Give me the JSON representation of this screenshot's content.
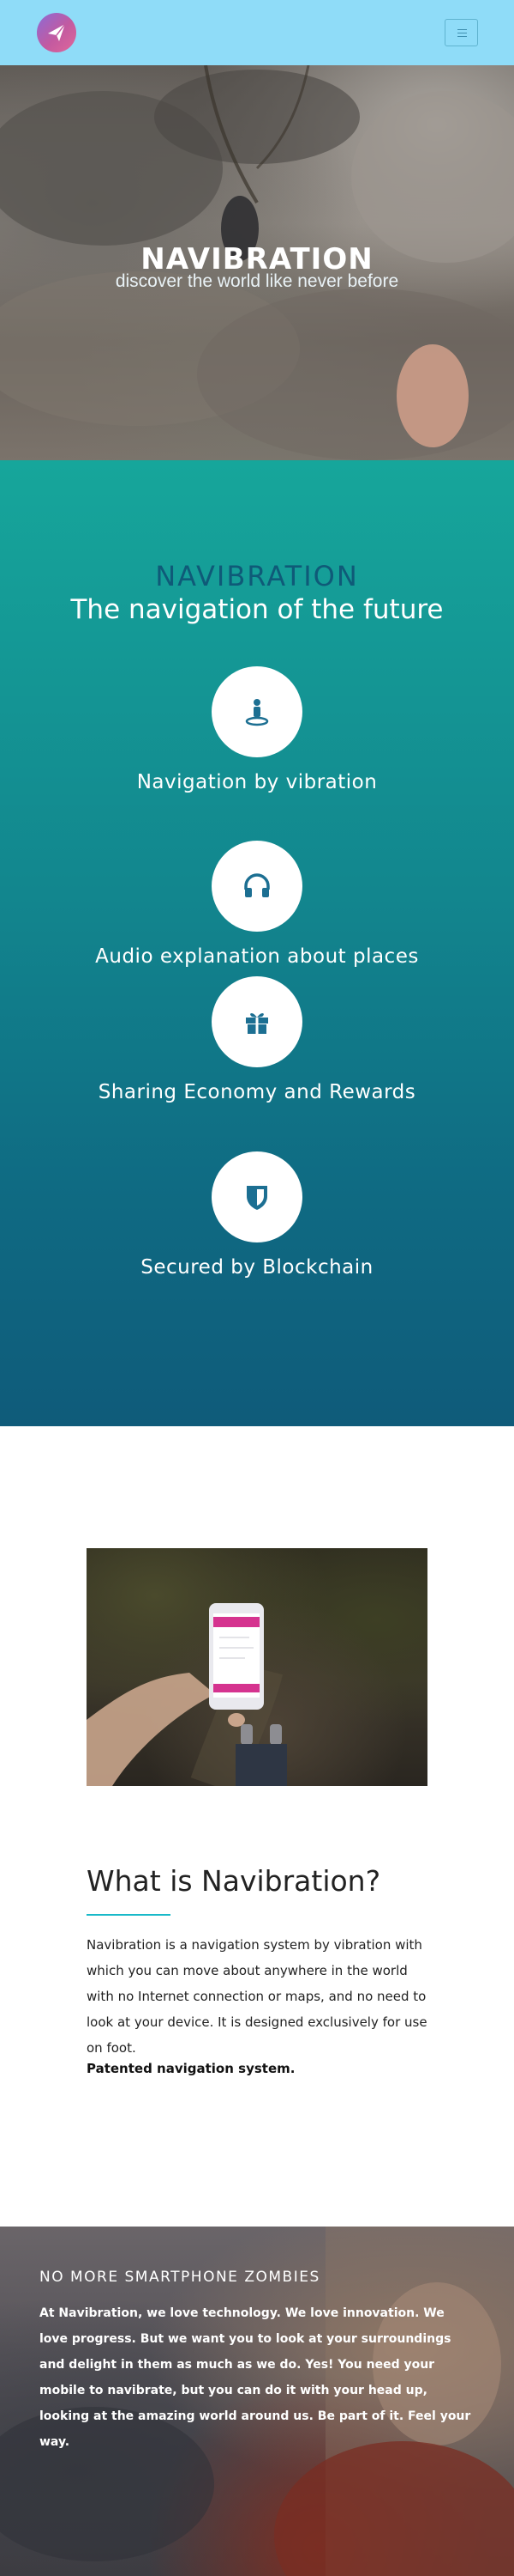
{
  "header": {
    "logo_icon": "paper-plane-icon",
    "menu_icon": "hamburger-menu-icon"
  },
  "hero": {
    "title": "NAVIBRATION",
    "subtitle": "discover the world like never before"
  },
  "features": {
    "brand": "NAVIBRATION",
    "tagline": "The navigation of the future",
    "items": [
      {
        "icon": "person-pin-icon",
        "label": "Navigation by vibration"
      },
      {
        "icon": "headphones-icon",
        "label": "Audio explanation about places"
      },
      {
        "icon": "gift-icon",
        "label": "Sharing Economy and Rewards"
      },
      {
        "icon": "shield-icon",
        "label": "Secured by Blockchain"
      }
    ]
  },
  "about": {
    "title": "What is Navibration?",
    "text": "Navibration is a navigation system by vibration with which you can move about anywhere in the world with no Internet connection or maps, and no need to look at your device. It is designed exclusively for use on foot.",
    "strong": "Patented navigation system."
  },
  "zombies": {
    "title": "NO MORE SMARTPHONE ZOMBIES",
    "text": "At Navibration, we love technology. We love innovation. We love progress. But we want you to look at your surroundings and delight in them as much as we do. Yes! You need your mobile to navibrate, but you can do it with your head up, looking at the amazing world around us. Be part of it. Feel your way."
  },
  "colors": {
    "header_bg": "#8fdcf8",
    "teal_top": "#16a69b",
    "teal_bottom": "#0f5b7a",
    "brand_dark": "#0f5a78",
    "accent_line": "#19b9c9"
  }
}
